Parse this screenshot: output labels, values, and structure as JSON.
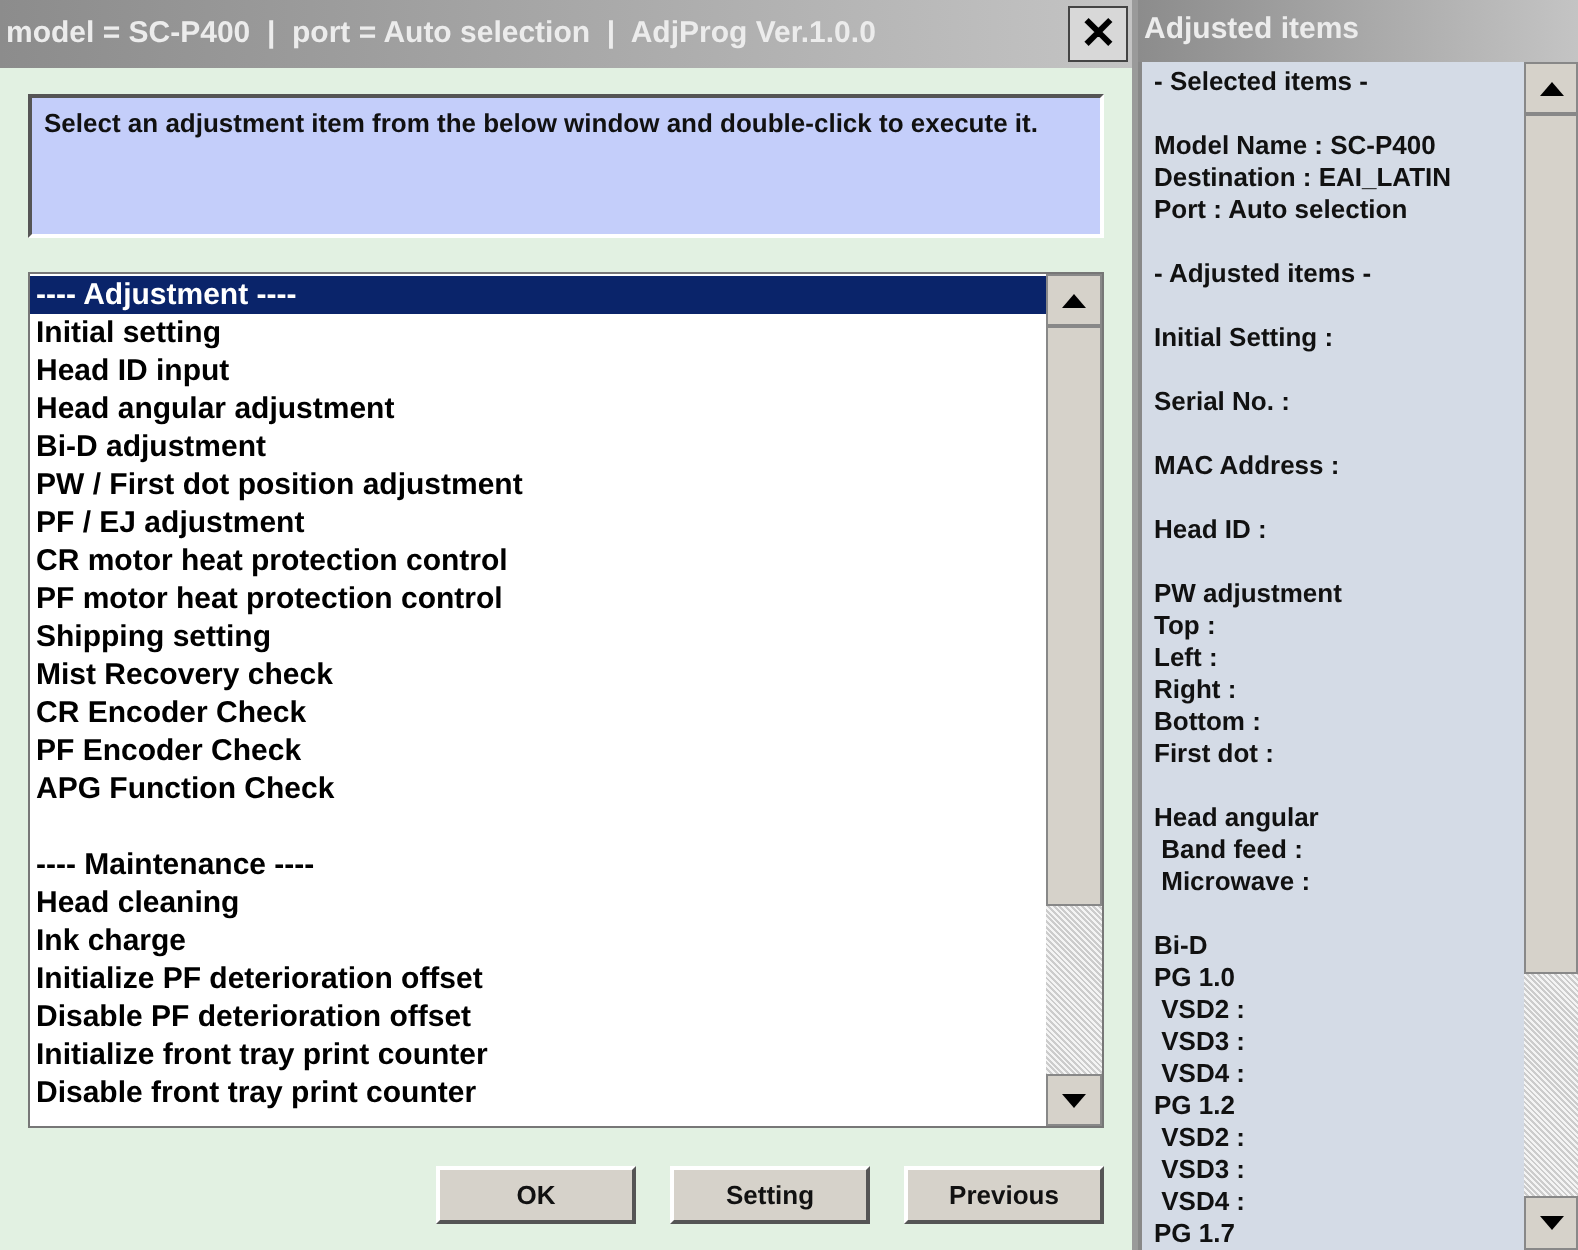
{
  "window": {
    "title": "model = SC-P400  |  port = Auto selection  |  AdjProg Ver.1.0.0",
    "close": "✕"
  },
  "instruction": "Select an adjustment item from the below window and double-click to execute it.",
  "list": {
    "sections": [
      {
        "items": [
          {
            "label": "---- Adjustment ----",
            "selected": true
          },
          {
            "label": "Initial setting",
            "selected": false
          },
          {
            "label": "Head ID input",
            "selected": false
          },
          {
            "label": "Head angular adjustment",
            "selected": false
          },
          {
            "label": "Bi-D adjustment",
            "selected": false
          },
          {
            "label": "PW / First dot position adjustment",
            "selected": false
          },
          {
            "label": "PF / EJ adjustment",
            "selected": false
          },
          {
            "label": "CR motor heat protection control",
            "selected": false
          },
          {
            "label": "PF motor heat protection control",
            "selected": false
          },
          {
            "label": "Shipping setting",
            "selected": false
          },
          {
            "label": "Mist Recovery check",
            "selected": false
          },
          {
            "label": "CR Encoder Check",
            "selected": false
          },
          {
            "label": "PF Encoder Check",
            "selected": false
          },
          {
            "label": "APG Function Check",
            "selected": false
          }
        ]
      },
      {
        "items": [
          {
            "label": "---- Maintenance ----",
            "selected": false
          },
          {
            "label": "Head cleaning",
            "selected": false
          },
          {
            "label": "Ink charge",
            "selected": false
          },
          {
            "label": "Initialize PF deterioration offset",
            "selected": false
          },
          {
            "label": "Disable PF deterioration offset",
            "selected": false
          },
          {
            "label": "Initialize front tray print counter",
            "selected": false
          },
          {
            "label": "Disable front tray print counter",
            "selected": false
          }
        ]
      }
    ]
  },
  "buttons": [
    "OK",
    "Setting",
    "Previous"
  ],
  "side_panel": {
    "title": "Adjusted items",
    "groups": [
      [
        "- Selected items -"
      ],
      [
        "Model Name : SC-P400",
        "Destination : EAI_LATIN",
        "Port : Auto selection"
      ],
      [
        "- Adjusted items -"
      ],
      [
        "Initial Setting :"
      ],
      [
        "Serial No. :"
      ],
      [
        "MAC Address :"
      ],
      [
        "Head ID :"
      ],
      [
        "PW adjustment",
        "Top :",
        "Left :",
        "Right :",
        "Bottom :",
        "First dot :"
      ],
      [
        "Head angular",
        " Band feed :",
        " Microwave :"
      ],
      [
        "Bi-D",
        "PG 1.0",
        " VSD2 :",
        " VSD3 :",
        " VSD4 :",
        "PG 1.2",
        " VSD2 :",
        " VSD3 :",
        " VSD4 :",
        "PG 1.7"
      ]
    ]
  }
}
